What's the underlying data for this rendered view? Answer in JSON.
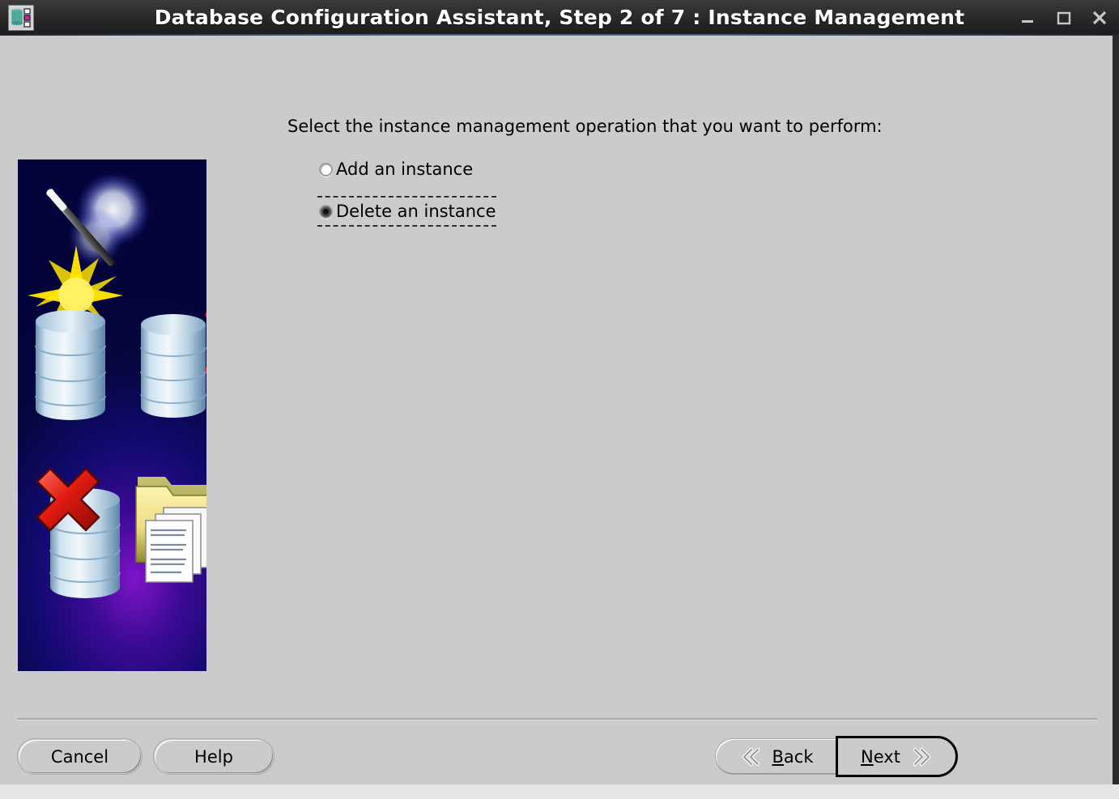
{
  "window": {
    "title": "Database Configuration Assistant, Step 2 of 7 : Instance Management",
    "icon_name": "database-config-assistant-icon",
    "controls": {
      "minimize_label": "Minimize",
      "maximize_label": "Maximize",
      "close_label": "Close"
    },
    "colors": {
      "titlebar_bg": "#2b2b2b",
      "titlebar_text": "#ffffff",
      "client_bg": "#cbcbcb",
      "default_button_border": "#000000"
    }
  },
  "main": {
    "prompt": "Select the instance management operation that you want to perform:",
    "options": [
      {
        "label": "Add an instance",
        "selected": false,
        "focused": false
      },
      {
        "label": "Delete an instance",
        "selected": true,
        "focused": true
      }
    ]
  },
  "banner": {
    "alt": "Wizard magic wand with database cylinders, checkmarks, a deleted database marked with a red X, and a folder of documents",
    "bg_start": "#0b16e8",
    "bg_end": "#04043a",
    "accent_purple": "#7d14c8",
    "sparkle_color": "#ffe500",
    "check_color": "#d71920",
    "folder_color": "#f0e08a"
  },
  "footer": {
    "cancel_label": "Cancel",
    "help_label": "Help",
    "back": {
      "label": "Back",
      "mnemonic": "B",
      "rest": "ack",
      "icon": "chevron-left-double-icon"
    },
    "next": {
      "label": "Next",
      "mnemonic": "N",
      "rest": "ext",
      "icon": "chevron-right-double-icon",
      "is_default": true
    }
  }
}
